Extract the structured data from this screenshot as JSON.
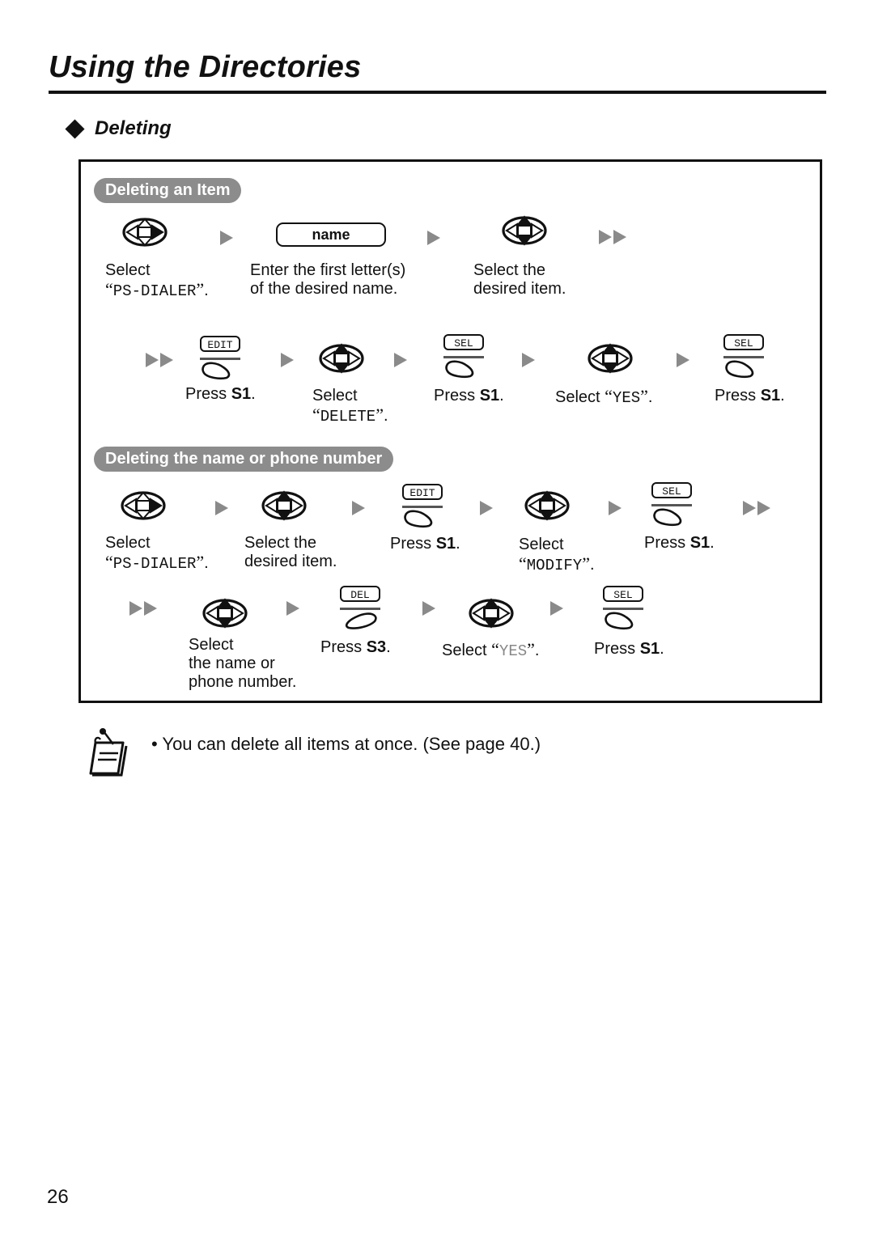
{
  "header": {
    "title": "Using the Directories"
  },
  "section": {
    "title": "Deleting"
  },
  "procedures": [
    {
      "heading": "Deleting an Item",
      "steps": [
        {
          "icon": "navigator-right",
          "text": "Select",
          "value": "PS-DIALER",
          "suffix": "."
        },
        {
          "icon": "name-key",
          "key_label": "name",
          "line1": "Enter the first letter(s)",
          "line2": "of the desired name."
        },
        {
          "icon": "navigator-updown",
          "line1": "Select the",
          "line2": "desired item."
        },
        {
          "icon": "softkey",
          "key_label": "EDIT",
          "text": "Press ",
          "key": "S1",
          "suffix": "."
        },
        {
          "icon": "navigator-updown",
          "text": "Select",
          "value": "DELETE",
          "suffix": "."
        },
        {
          "icon": "softkey",
          "key_label": "SEL",
          "text": "Press ",
          "key": "S1",
          "suffix": "."
        },
        {
          "icon": "navigator-updown",
          "text": "Select ",
          "value": "YES",
          "suffix": "."
        },
        {
          "icon": "softkey",
          "key_label": "SEL",
          "text": "Press ",
          "key": "S1",
          "suffix": "."
        }
      ]
    },
    {
      "heading": "Deleting the name or phone number",
      "steps": [
        {
          "icon": "navigator-right",
          "text": "Select",
          "value": "PS-DIALER",
          "suffix": "."
        },
        {
          "icon": "navigator-updown",
          "line1": "Select the",
          "line2": "desired item."
        },
        {
          "icon": "softkey",
          "key_label": "EDIT",
          "text": "Press ",
          "key": "S1",
          "suffix": "."
        },
        {
          "icon": "navigator-updown",
          "text": "Select",
          "value": "MODIFY",
          "suffix": "."
        },
        {
          "icon": "softkey",
          "key_label": "SEL",
          "text": "Press ",
          "key": "S1",
          "suffix": "."
        },
        {
          "icon": "navigator-updown",
          "line1": "Select",
          "line2": "the name or",
          "line3": "phone number."
        },
        {
          "icon": "softkey",
          "key_label": "DEL",
          "text": "Press ",
          "key": "S3",
          "suffix": "."
        },
        {
          "icon": "navigator-updown",
          "text": "Select ",
          "value": "YES",
          "suffix": "."
        },
        {
          "icon": "softkey",
          "key_label": "SEL",
          "text": "Press ",
          "key": "S1",
          "suffix": "."
        }
      ]
    }
  ],
  "quote_open": "“",
  "quote_close": "”",
  "note": {
    "icon": "memo-note-icon",
    "text": "• You can delete all items at once. (See page 40.)"
  },
  "footer": {
    "page_number": "26"
  }
}
